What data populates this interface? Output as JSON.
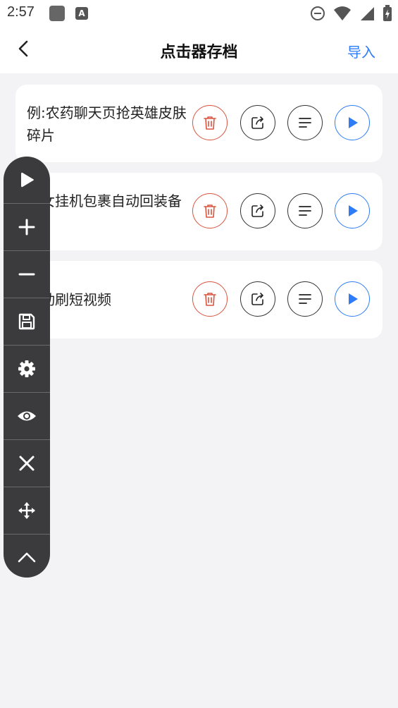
{
  "status_bar": {
    "time": "2:57",
    "icons": [
      "app-square-icon",
      "a-badge-icon",
      "dnd-icon",
      "wifi-icon",
      "signal-icon",
      "battery-icon"
    ],
    "a_badge": "A"
  },
  "header": {
    "title": "点击器存档",
    "action_label": "导入",
    "back_icon": "chevron-left-icon"
  },
  "items": [
    {
      "title": "例:农药聊天页抢英雄皮肤碎片"
    },
    {
      "title": "情女挂机包裹自动回装备"
    },
    {
      "title": "自动刷短视频"
    }
  ],
  "item_actions": [
    "trash-icon",
    "share-icon",
    "list-icon",
    "play-icon"
  ],
  "float_toolbar": [
    "play-icon",
    "plus-icon",
    "minus-icon",
    "save-icon",
    "gear-icon",
    "eye-icon",
    "close-icon",
    "move-icon",
    "chevron-up-icon"
  ],
  "colors": {
    "accent": "#2f7df6",
    "danger": "#d9543f",
    "toolbar_bg": "#3b3b3d",
    "page_bg": "#f3f3f6"
  }
}
